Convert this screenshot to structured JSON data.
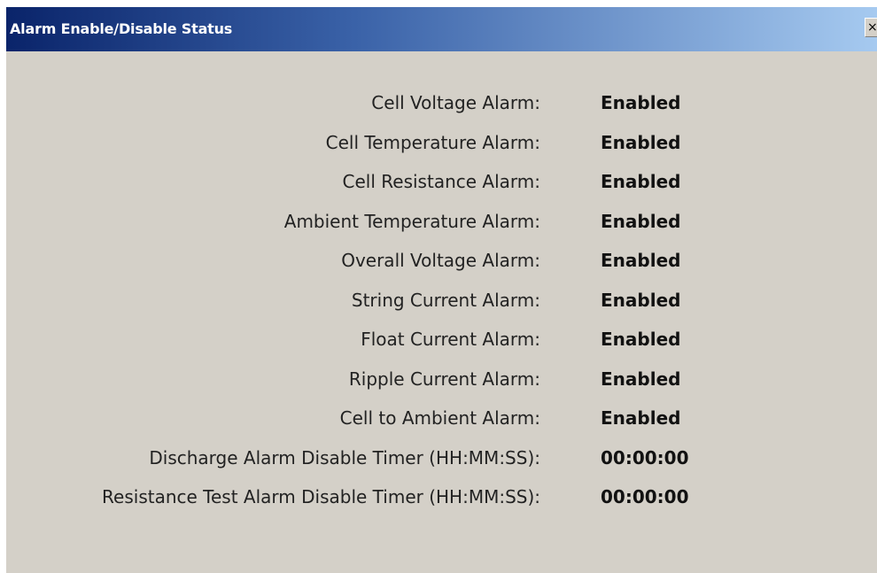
{
  "window": {
    "title": "Alarm Enable/Disable Status",
    "close_glyph": "×",
    "close_icon": "close-icon"
  },
  "colors": {
    "titlebar_start": "#0a246a",
    "titlebar_end": "#a6caf0",
    "dialog_background": "#d4d0c8"
  },
  "rows": [
    {
      "label": "Cell Voltage Alarm:",
      "value": "Enabled"
    },
    {
      "label": "Cell Temperature Alarm:",
      "value": "Enabled"
    },
    {
      "label": "Cell Resistance Alarm:",
      "value": "Enabled"
    },
    {
      "label": "Ambient Temperature Alarm:",
      "value": "Enabled"
    },
    {
      "label": "Overall Voltage Alarm:",
      "value": "Enabled"
    },
    {
      "label": "String Current Alarm:",
      "value": "Enabled"
    },
    {
      "label": "Float Current Alarm:",
      "value": "Enabled"
    },
    {
      "label": "Ripple Current Alarm:",
      "value": "Enabled"
    },
    {
      "label": "Cell to Ambient Alarm:",
      "value": "Enabled"
    },
    {
      "label": "Discharge Alarm Disable Timer (HH:MM:SS):",
      "value": "00:00:00"
    },
    {
      "label": "Resistance Test Alarm Disable Timer (HH:MM:SS):",
      "value": "00:00:00"
    }
  ]
}
